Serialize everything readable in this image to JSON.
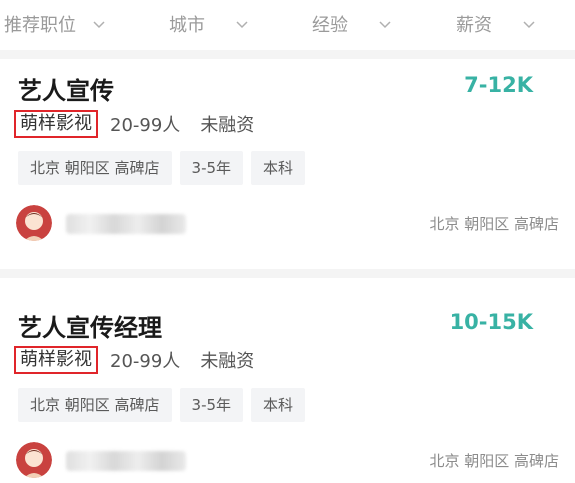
{
  "filters": [
    {
      "label": "推荐职位"
    },
    {
      "label": "城市"
    },
    {
      "label": "经验"
    },
    {
      "label": "薪资"
    }
  ],
  "jobs": [
    {
      "title": "艺人宣传",
      "salary": "7-12K",
      "company": "萌样影视",
      "size": "20-99人",
      "funding": "未融资",
      "tags": [
        "北京 朝阳区 高碑店",
        "3-5年",
        "本科"
      ],
      "location": "北京 朝阳区 高碑店",
      "salary_color": "#38b2a4",
      "highlight_color": "#e0252a"
    },
    {
      "title": "艺人宣传经理",
      "salary": "10-15K",
      "company": "萌样影视",
      "size": "20-99人",
      "funding": "未融资",
      "tags": [
        "北京 朝阳区 高碑店",
        "3-5年",
        "本科"
      ],
      "location": "北京 朝阳区 高碑店",
      "salary_color": "#38b2a4",
      "highlight_color": "#e0252a"
    }
  ],
  "icons": [
    "chevron-down-icon",
    "avatar-icon"
  ]
}
